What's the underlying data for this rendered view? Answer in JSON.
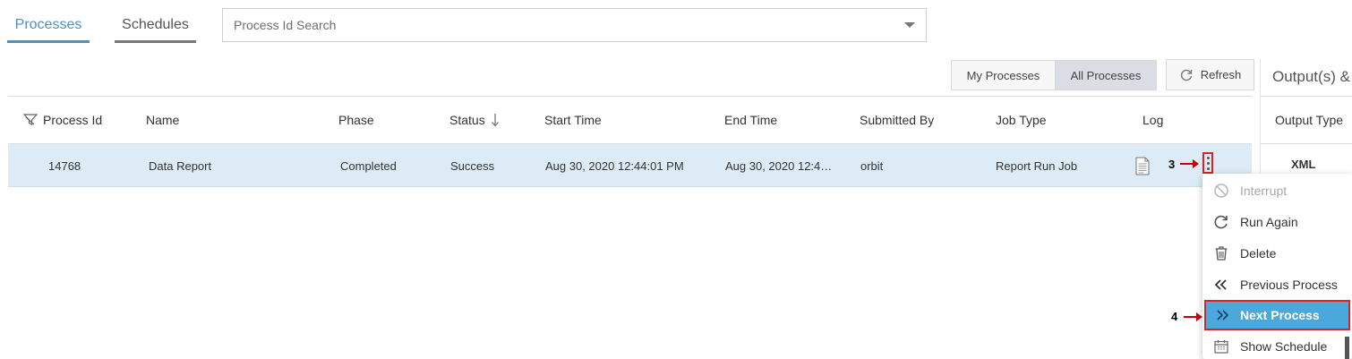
{
  "tabs": [
    {
      "label": "Processes",
      "active": true
    },
    {
      "label": "Schedules",
      "active": false
    }
  ],
  "search": {
    "placeholder": "Process Id Search",
    "value": ""
  },
  "toggle": {
    "my_label": "My Processes",
    "all_label": "All Processes",
    "selected": "All Processes"
  },
  "refresh_label": "Refresh",
  "output_panel": {
    "title": "Output(s) &",
    "column": "Output Type",
    "rows": [
      "XML"
    ]
  },
  "table": {
    "columns": [
      "Process Id",
      "Name",
      "Phase",
      "Status",
      "Start Time",
      "End Time",
      "Submitted By",
      "Job Type",
      "Log"
    ],
    "sort": {
      "column": "Status",
      "direction": "descending"
    },
    "rows": [
      {
        "process_id": "14768",
        "name": "Data Report",
        "phase": "Completed",
        "status": "Success",
        "start_time": "Aug 30, 2020 12:44:01 PM",
        "end_time": "Aug 30, 2020 12:4…",
        "submitted_by": "orbit",
        "job_type": "Report Run Job",
        "log_icon": "document-icon"
      }
    ]
  },
  "annotations": {
    "step3": "3",
    "step4": "4"
  },
  "menu": {
    "items": [
      {
        "label": "Interrupt",
        "icon": "ban-icon",
        "disabled": true
      },
      {
        "label": "Run Again",
        "icon": "redo-icon",
        "disabled": false
      },
      {
        "label": "Delete",
        "icon": "trash-icon",
        "disabled": false
      },
      {
        "label": "Previous Process",
        "icon": "double-chevron-left-icon",
        "disabled": false
      },
      {
        "label": "Next Process",
        "icon": "double-chevron-right-icon",
        "disabled": false,
        "highlighted": true
      },
      {
        "label": "Show Schedule",
        "icon": "calendar-icon",
        "disabled": false
      }
    ]
  },
  "colors": {
    "accent": "#4a90c9",
    "row_highlight": "#dcebf5",
    "menu_active": "#4aa8dc",
    "annotation_red": "#cc0000"
  }
}
